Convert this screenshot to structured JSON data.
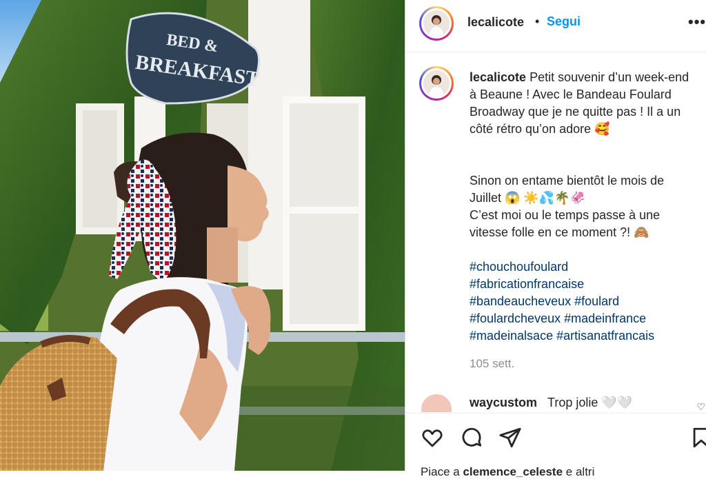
{
  "post": {
    "username": "lecalicote",
    "separator": "•",
    "follow_label": "Segui",
    "more_label": "•••",
    "caption": {
      "username": "lecalicote",
      "line1": "Petit souvenir d’un week-end à Beaune ! Avec le Bandeau Foulard Broadway que je ne quitte pas ! Il a un côté rétro qu’on adore 🥰",
      "line2": "Sinon on entame bientôt le mois de Juillet 😱 ☀️💦🌴🦑",
      "line3": "C’est moi ou le temps passe à une vitesse folle en ce moment ?! 🙈",
      "hashtags": [
        "#chouchoufoulard",
        "#fabricationfrancaise",
        "#bandeaucheveux #foulard",
        "#foulardcheveux #madeinfrance",
        "#madeinalsace #artisanatfrancais"
      ]
    },
    "time_ago": "105 sett.",
    "comment": {
      "username": "waycustom",
      "text": "Trop jolie 🤍🤍",
      "like_icon": "heart-outline-icon"
    },
    "likes": {
      "prefix": "Piace a",
      "bold1": "clemence_celeste",
      "suffix": "e altri"
    }
  },
  "photo": {
    "sign_line1": "BED &",
    "sign_line2": "BREAKFAST"
  },
  "icons": {
    "like": "heart-icon",
    "comment": "comment-icon",
    "share": "paper-plane-icon",
    "save": "bookmark-icon"
  },
  "colors": {
    "follow": "#0095f6",
    "hashtag": "#00376b",
    "muted": "#8e8e8e"
  }
}
